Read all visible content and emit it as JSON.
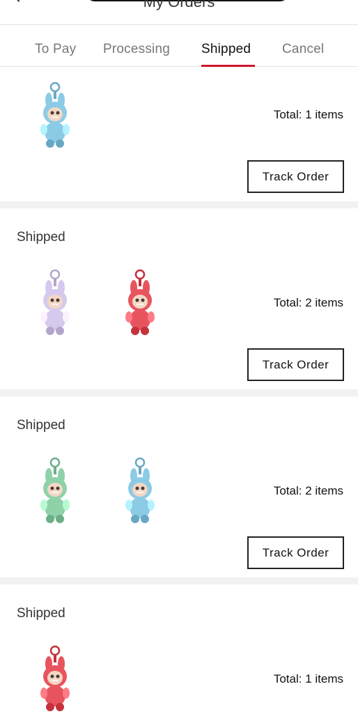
{
  "header": {
    "title": "My Orders"
  },
  "tabs": [
    {
      "label": "To Pay",
      "active": false
    },
    {
      "label": "Processing",
      "active": false
    },
    {
      "label": "Shipped",
      "active": true
    },
    {
      "label": "Cancel",
      "active": false
    }
  ],
  "accent_color": "#d0152d",
  "orders": [
    {
      "status": "",
      "total": "Total: 1 items",
      "button": "Track Order",
      "products": [
        {
          "name": "blue plush keychain doll",
          "color": "#8ccbe6"
        }
      ]
    },
    {
      "status": "Shipped",
      "total": "Total: 2 items",
      "button": "Track Order",
      "products": [
        {
          "name": "lavender plush keychain doll",
          "color": "#d6c9ee"
        },
        {
          "name": "red plush keychain doll",
          "color": "#e8545e"
        }
      ]
    },
    {
      "status": "Shipped",
      "total": "Total: 2 items",
      "button": "Track Order",
      "products": [
        {
          "name": "green plush keychain doll",
          "color": "#8fd1a9"
        },
        {
          "name": "blue plush keychain doll",
          "color": "#8ccbe6"
        }
      ]
    },
    {
      "status": "Shipped",
      "total": "Total: 1 items",
      "button": "",
      "products": [
        {
          "name": "red plush keychain doll",
          "color": "#e8545e"
        }
      ]
    }
  ]
}
